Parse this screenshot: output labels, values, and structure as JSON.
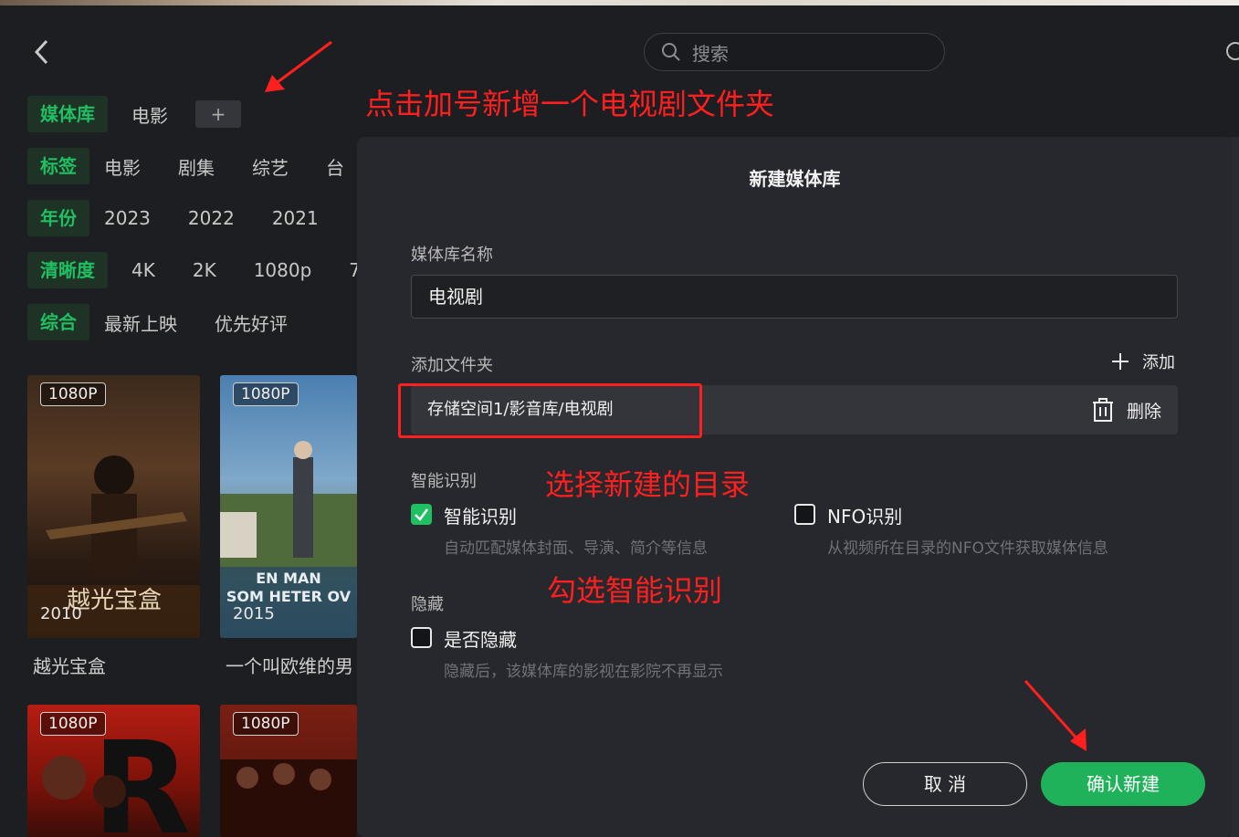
{
  "header": {
    "search_placeholder": "搜索"
  },
  "filters": {
    "library": {
      "label": "媒体库",
      "items": [
        "电影"
      ],
      "add_label": "+"
    },
    "tags": {
      "label": "标签",
      "items": [
        "电影",
        "剧集",
        "综艺",
        "台"
      ]
    },
    "years": {
      "label": "年份",
      "items": [
        "2023",
        "2022",
        "2021"
      ]
    },
    "resolution": {
      "label": "清晰度",
      "items": [
        "4K",
        "2K",
        "1080p",
        "7"
      ]
    },
    "sort": {
      "label": "综合",
      "items": [
        "最新上映",
        "优先好评"
      ]
    }
  },
  "posters": [
    {
      "badge": "1080P",
      "year": "2010",
      "title": "越光宝盒",
      "art_text": "越光宝盒"
    },
    {
      "badge": "1080P",
      "year": "2015",
      "title": "一个叫欧维的男",
      "art_text": "EN MAN SOM HETER OV"
    },
    {
      "badge": "1080P",
      "year": "",
      "title": "",
      "art_text": "R"
    },
    {
      "badge": "1080P",
      "year": "",
      "title": "",
      "art_text": ""
    }
  ],
  "modal": {
    "title": "新建媒体库",
    "name_label": "媒体库名称",
    "name_value": "电视剧",
    "folder_label": "添加文件夹",
    "add_label": "添加",
    "folder_path": "存储空间1/影音库/电视剧",
    "delete_label": "删除",
    "smart_section_label": "智能识别",
    "smart_option": {
      "label": "智能识别",
      "desc": "自动匹配媒体封面、导演、简介等信息",
      "checked": true
    },
    "nfo_option": {
      "label": "NFO识别",
      "desc": "从视频所在目录的NFO文件获取媒体信息",
      "checked": false
    },
    "hidden_section_label": "隐藏",
    "hidden_option": {
      "label": "是否隐藏",
      "desc": "隐藏后，该媒体库的影视在影院不再显示",
      "checked": false
    },
    "cancel_label": "取 消",
    "confirm_label": "确认新建"
  },
  "annotations": {
    "plus_hint": "点击加号新增一个电视剧文件夹",
    "folder_hint": "选择新建的目录",
    "smart_hint": "勾选智能识别",
    "color": "#ff1f1f"
  },
  "colors": {
    "accent": "#1fbf62",
    "background": "#1d1e22",
    "modal": "#27282d"
  }
}
